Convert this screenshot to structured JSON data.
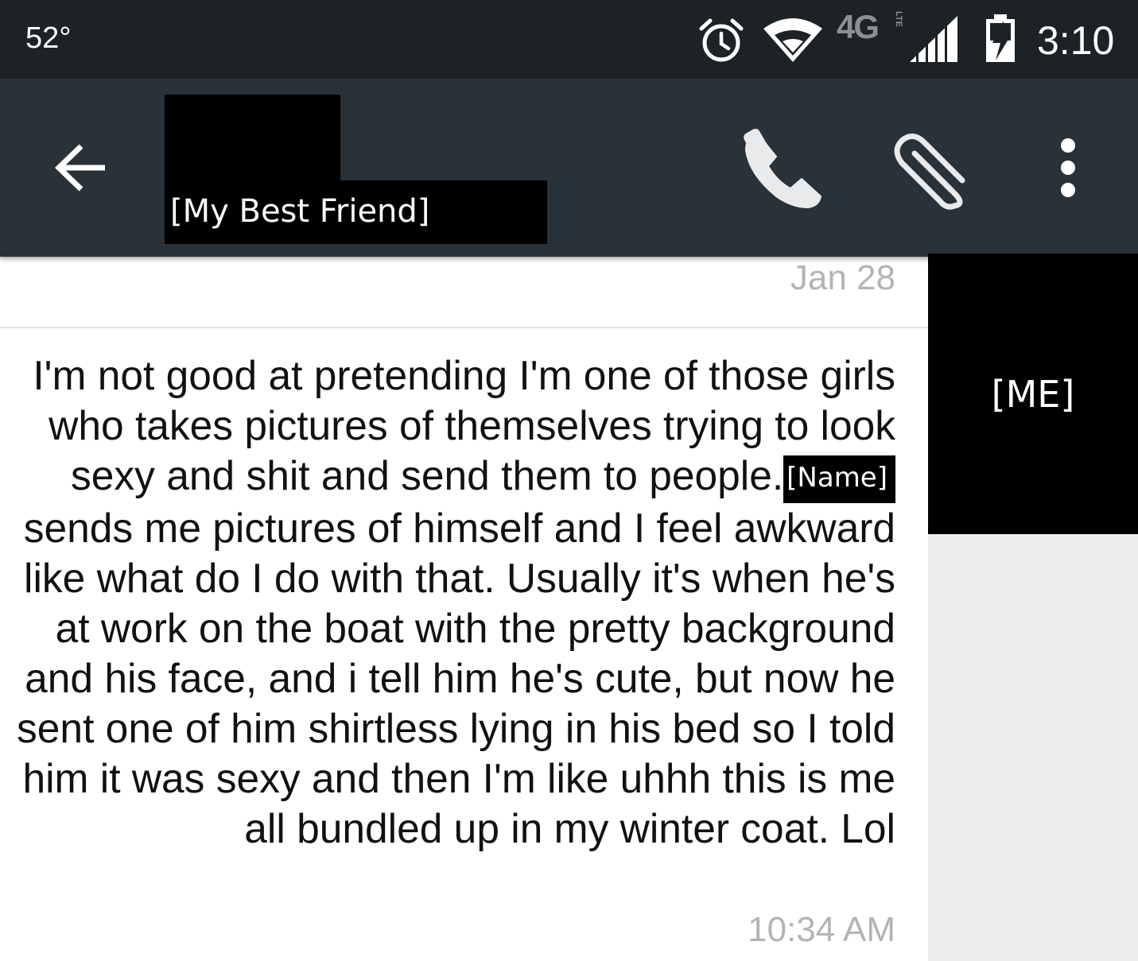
{
  "status_bar": {
    "temperature": "52°",
    "network_label": "4G",
    "network_sub": "LTE",
    "time": "3:10",
    "icons": [
      "alarm-icon",
      "wifi-icon",
      "cell-signal-icon",
      "battery-charging-icon"
    ]
  },
  "toolbar": {
    "contact_name": "[My Best Friend]",
    "icons": [
      "back-arrow-icon",
      "phone-icon",
      "paperclip-icon",
      "overflow-menu-icon"
    ],
    "colors": {
      "background": "#283238",
      "status_bar": "#1c2226"
    }
  },
  "conversation": {
    "date": "Jan 28",
    "message": {
      "text_before": "I'm not good at pretending I'm one of those girls who takes pictures of themselves trying to look sexy and shit and send them to people.",
      "redacted_name": "[Name]",
      "text_after": " sends me pictures of himself and I feel awkward like what do I do with that. Usually it's when he's at work on the boat with the pretty background and his face, and i tell him he's cute, but now he sent one of him shirtless lying in his bed so I told him it was sexy and then I'm like uhhh this is me all bundled up in my winter coat. Lol",
      "time": "10:34 AM"
    }
  },
  "self_avatar": {
    "label": "[ME]"
  }
}
